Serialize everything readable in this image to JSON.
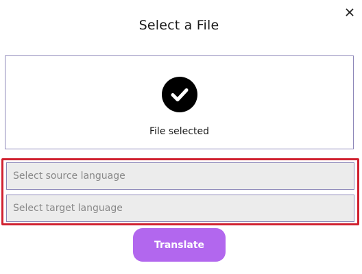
{
  "modal": {
    "title": "Select a File",
    "close_icon": "close-icon"
  },
  "dropzone": {
    "status_icon": "check-circle-icon",
    "status_text": "File selected"
  },
  "languages": {
    "source_placeholder": "Select source language",
    "source_value": "",
    "target_placeholder": "Select target language",
    "target_value": ""
  },
  "actions": {
    "translate_label": "Translate"
  },
  "colors": {
    "accent": "#b267ee",
    "highlight_border": "#d0202f",
    "field_border": "#8c86b8",
    "field_background": "#ececec"
  }
}
